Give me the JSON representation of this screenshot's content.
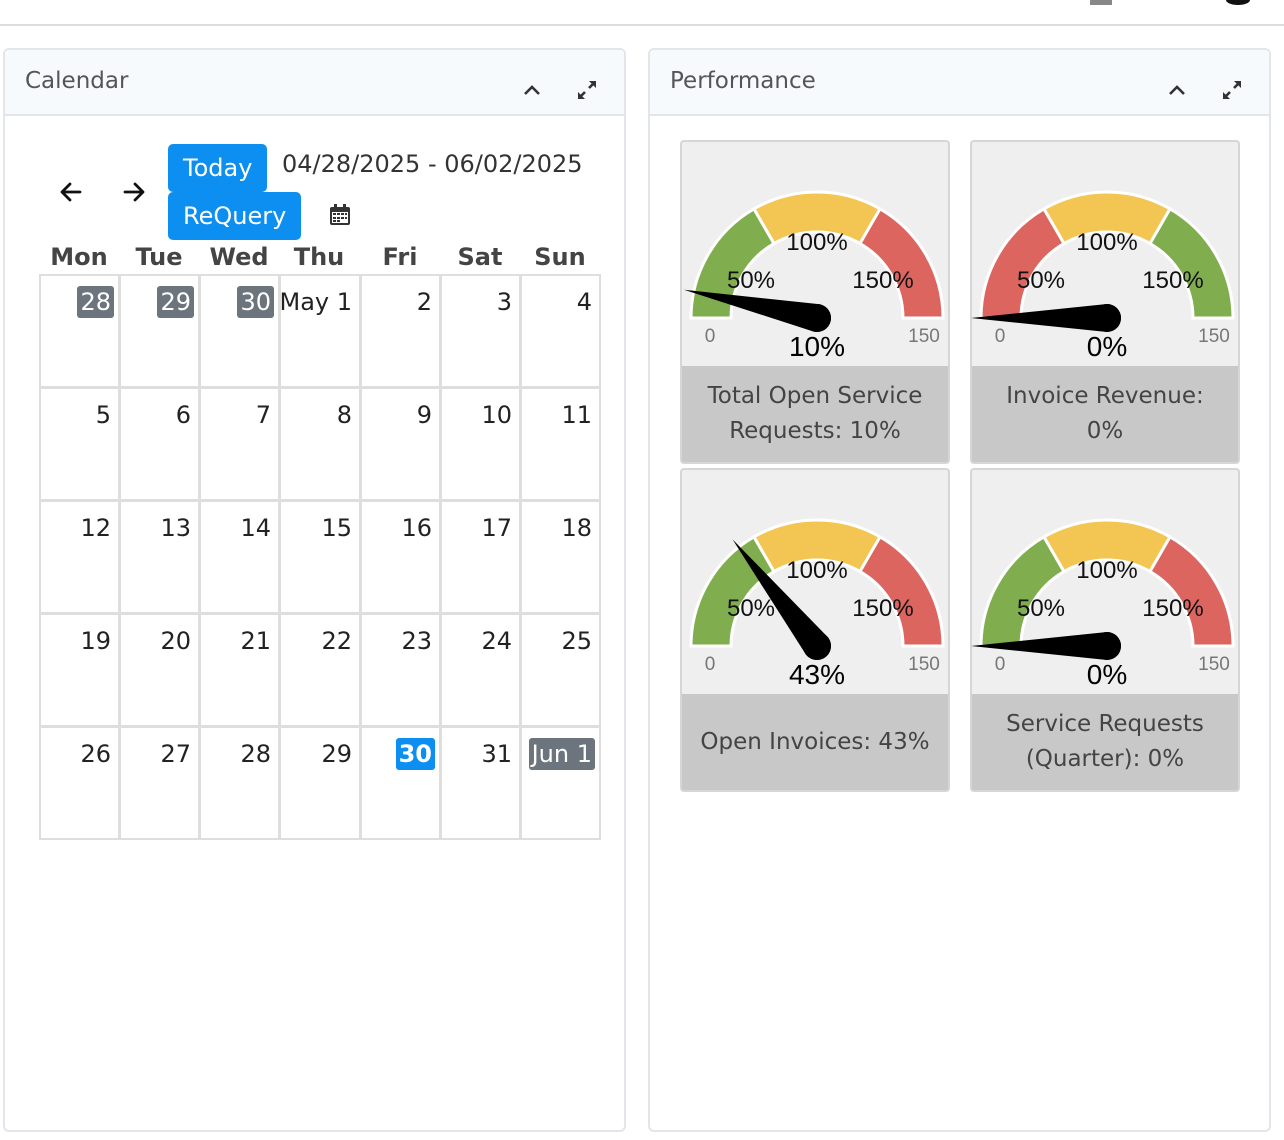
{
  "calendar": {
    "title": "Calendar",
    "today_label": "Today",
    "requery_label": "ReQuery",
    "date_range": "04/28/2025 - 06/02/2025",
    "weekdays": [
      "Mon",
      "Tue",
      "Wed",
      "Thu",
      "Fri",
      "Sat",
      "Sun"
    ],
    "weeks": [
      [
        {
          "label": "28",
          "kind": "other"
        },
        {
          "label": "29",
          "kind": "other"
        },
        {
          "label": "30",
          "kind": "other"
        },
        {
          "label": "May 1",
          "kind": "normal"
        },
        {
          "label": "2",
          "kind": "normal"
        },
        {
          "label": "3",
          "kind": "normal"
        },
        {
          "label": "4",
          "kind": "normal"
        }
      ],
      [
        {
          "label": "5",
          "kind": "normal"
        },
        {
          "label": "6",
          "kind": "normal"
        },
        {
          "label": "7",
          "kind": "normal"
        },
        {
          "label": "8",
          "kind": "normal"
        },
        {
          "label": "9",
          "kind": "normal"
        },
        {
          "label": "10",
          "kind": "normal"
        },
        {
          "label": "11",
          "kind": "normal"
        }
      ],
      [
        {
          "label": "12",
          "kind": "normal"
        },
        {
          "label": "13",
          "kind": "normal"
        },
        {
          "label": "14",
          "kind": "normal"
        },
        {
          "label": "15",
          "kind": "normal"
        },
        {
          "label": "16",
          "kind": "normal"
        },
        {
          "label": "17",
          "kind": "normal"
        },
        {
          "label": "18",
          "kind": "normal"
        }
      ],
      [
        {
          "label": "19",
          "kind": "normal"
        },
        {
          "label": "20",
          "kind": "normal"
        },
        {
          "label": "21",
          "kind": "normal"
        },
        {
          "label": "22",
          "kind": "normal"
        },
        {
          "label": "23",
          "kind": "normal"
        },
        {
          "label": "24",
          "kind": "normal"
        },
        {
          "label": "25",
          "kind": "normal"
        }
      ],
      [
        {
          "label": "26",
          "kind": "normal"
        },
        {
          "label": "27",
          "kind": "normal"
        },
        {
          "label": "28",
          "kind": "normal"
        },
        {
          "label": "29",
          "kind": "normal"
        },
        {
          "label": "30",
          "kind": "today"
        },
        {
          "label": "31",
          "kind": "normal"
        },
        {
          "label": "Jun 1",
          "kind": "other"
        }
      ]
    ]
  },
  "performance": {
    "title": "Performance",
    "gauges": [
      {
        "label": "Total Open Service Requests: 10%",
        "value": 10,
        "value_text": "10%",
        "min_text": "0",
        "max_text": "150",
        "marks": [
          "50%",
          "100%",
          "150%"
        ],
        "zones": [
          "#80ad4d",
          "#f3c553",
          "#dc6560"
        ]
      },
      {
        "label": "Invoice Revenue: 0%",
        "value": 0,
        "value_text": "0%",
        "min_text": "0",
        "max_text": "150",
        "marks": [
          "50%",
          "100%",
          "150%"
        ],
        "zones": [
          "#dc6560",
          "#f3c553",
          "#80ad4d"
        ]
      },
      {
        "label": "Open Invoices: 43%",
        "value": 43,
        "value_text": "43%",
        "min_text": "0",
        "max_text": "150",
        "marks": [
          "50%",
          "100%",
          "150%"
        ],
        "zones": [
          "#80ad4d",
          "#f3c553",
          "#dc6560"
        ]
      },
      {
        "label": "Service Requests (Quarter): 0%",
        "value": 0,
        "value_text": "0%",
        "min_text": "0",
        "max_text": "150",
        "marks": [
          "50%",
          "100%",
          "150%"
        ],
        "zones": [
          "#80ad4d",
          "#f3c553",
          "#dc6560"
        ]
      }
    ]
  }
}
